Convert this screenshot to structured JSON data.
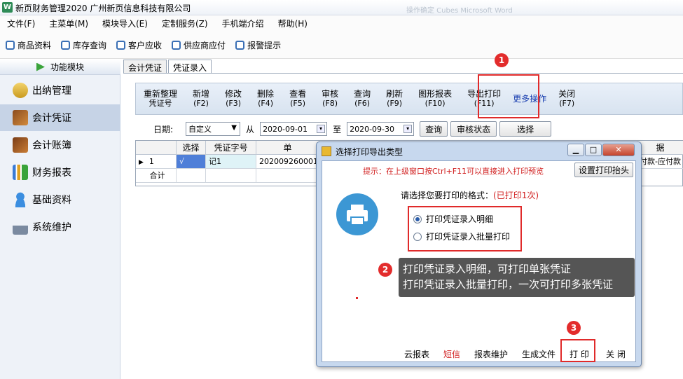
{
  "window": {
    "title": "新页财务管理2020 广州新页信息科技有限公司",
    "bg_text": "操作确定 Cubes Microsoft Word"
  },
  "menu": [
    "文件(F)",
    "主菜单(M)",
    "模块导入(E)",
    "定制服务(Z)",
    "手机端介绍",
    "帮助(H)"
  ],
  "quickbar": [
    "商品资料",
    "库存查询",
    "客户应收",
    "供应商应付",
    "报警提示"
  ],
  "sidebar": {
    "header": "功能模块",
    "items": [
      {
        "label": "出纳管理",
        "icon": "coins-icon"
      },
      {
        "label": "会计凭证",
        "icon": "ledger-book-icon",
        "active": true
      },
      {
        "label": "会计账簿",
        "icon": "account-book-icon"
      },
      {
        "label": "财务报表",
        "icon": "bar-chart-icon"
      },
      {
        "label": "基础资料",
        "icon": "user-icon"
      },
      {
        "label": "系统维护",
        "icon": "lock-icon"
      }
    ]
  },
  "tabs": [
    "会计凭证",
    "凭证录入"
  ],
  "toolbar": [
    {
      "label": "重新整理",
      "key": "凭证号"
    },
    {
      "label": "新增",
      "key": "(F2)"
    },
    {
      "label": "修改",
      "key": "(F3)"
    },
    {
      "label": "删除",
      "key": "(F4)"
    },
    {
      "label": "查看",
      "key": "(F5)"
    },
    {
      "label": "审核",
      "key": "(F8)"
    },
    {
      "label": "查询",
      "key": "(F6)"
    },
    {
      "label": "刷新",
      "key": "(F9)"
    },
    {
      "label": "图形报表",
      "key": "(F10)"
    },
    {
      "label": "导出打印",
      "key": "(F11)"
    },
    {
      "label": "更多操作",
      "key": ""
    },
    {
      "label": "关闭",
      "key": "(F7)"
    }
  ],
  "filter": {
    "date_label": "日期:",
    "range": "自定义",
    "from_label": "从",
    "from": "2020-09-01",
    "to_label": "至",
    "to": "2020-09-30",
    "query_btn": "查询",
    "audit_btn": "审核状态",
    "select_btn": "选择"
  },
  "grid": {
    "headers": [
      "选择",
      "凭证字号",
      "单",
      "据"
    ],
    "row": {
      "index": "1",
      "check": "√",
      "voucher": "记1",
      "bill": "202009260001",
      "tail": "付款-应付款"
    },
    "total_label": "合计"
  },
  "dialog": {
    "title": "选择打印导出类型",
    "hint": "提示：在上级窗口按Ctrl+F11可以直接进入打印预览",
    "setup_btn": "设置打印抬头",
    "prompt": "请选择您要打印的格式：",
    "printed": "(已打印1次)",
    "option1": "打印凭证录入明细",
    "option2": "打印凭证录入批量打印",
    "footer": [
      "云报表",
      "短信",
      "报表维护",
      "生成文件",
      "打 印",
      "关 闭"
    ],
    "sms_color": "#d12020"
  },
  "annotations": {
    "badge1": "1",
    "badge2": "2",
    "badge3": "3",
    "callout_line1": "打印凭证录入明细，可打印单张凭证",
    "callout_line2": "打印凭证录入批量打印，一次可打印多张凭证"
  }
}
